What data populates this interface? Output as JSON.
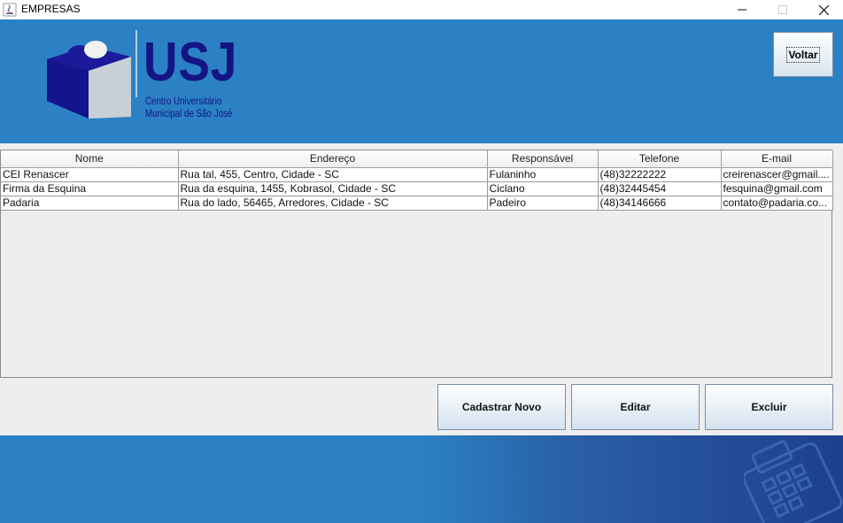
{
  "window": {
    "title": "EMPRESAS"
  },
  "logo": {
    "main": "USJ",
    "subtitle_line1": "Centro Universitário",
    "subtitle_line2": "Municipal de São José"
  },
  "header": {
    "voltar_label": "Voltar"
  },
  "table": {
    "columns": [
      "Nome",
      "Endereço",
      "Responsável",
      "Telefone",
      "E-mail"
    ],
    "rows": [
      [
        "CEI Renascer",
        "Rua tal, 455, Centro, Cidade - SC",
        "Fulaninho",
        "(48)32222222",
        "creirenascer@gmail...."
      ],
      [
        "Firma da Esquina",
        "Rua da esquina, 1455, Kobrasol, Cidade - SC",
        "Ciclano",
        "(48)32445454",
        "fesquina@gmail.com"
      ],
      [
        "Padaria",
        "Rua do lado, 56465, Arredores, Cidade - SC",
        "Padeiro",
        "(48)34146666",
        "contato@padaria.co..."
      ]
    ]
  },
  "actions": {
    "cadastrar_label": "Cadastrar Novo",
    "editar_label": "Editar",
    "excluir_label": "Excluir"
  },
  "colors": {
    "banner_blue": "#2b81c4",
    "logo_navy": "#141483"
  }
}
